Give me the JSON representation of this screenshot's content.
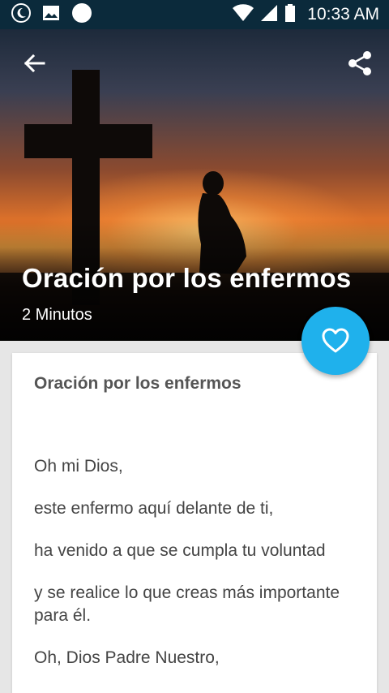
{
  "status_bar": {
    "time": "10:33 AM",
    "icons": [
      "moon-notification-icon",
      "image-notification-icon",
      "circle-notification-icon",
      "wifi-icon",
      "signal-icon",
      "battery-icon"
    ]
  },
  "header": {
    "title": "Oración por los enfermos",
    "subtitle": "2 Minutos",
    "back_icon": "arrow-back-icon",
    "share_icon": "share-icon"
  },
  "fab": {
    "icon": "heart-outline-icon",
    "color": "#1fb1ec"
  },
  "card": {
    "title": "Oración por los enfermos",
    "lines": [
      "Oh mi Dios,",
      "este enfermo aquí delante de ti,",
      "ha venido a que se cumpla tu voluntad",
      "y se realice lo que creas más importante para él.",
      "Oh, Dios Padre Nuestro,"
    ]
  },
  "colors": {
    "status_bar": "#0b2a3b",
    "accent": "#1fb1ec",
    "background": "#e6e6e6"
  }
}
